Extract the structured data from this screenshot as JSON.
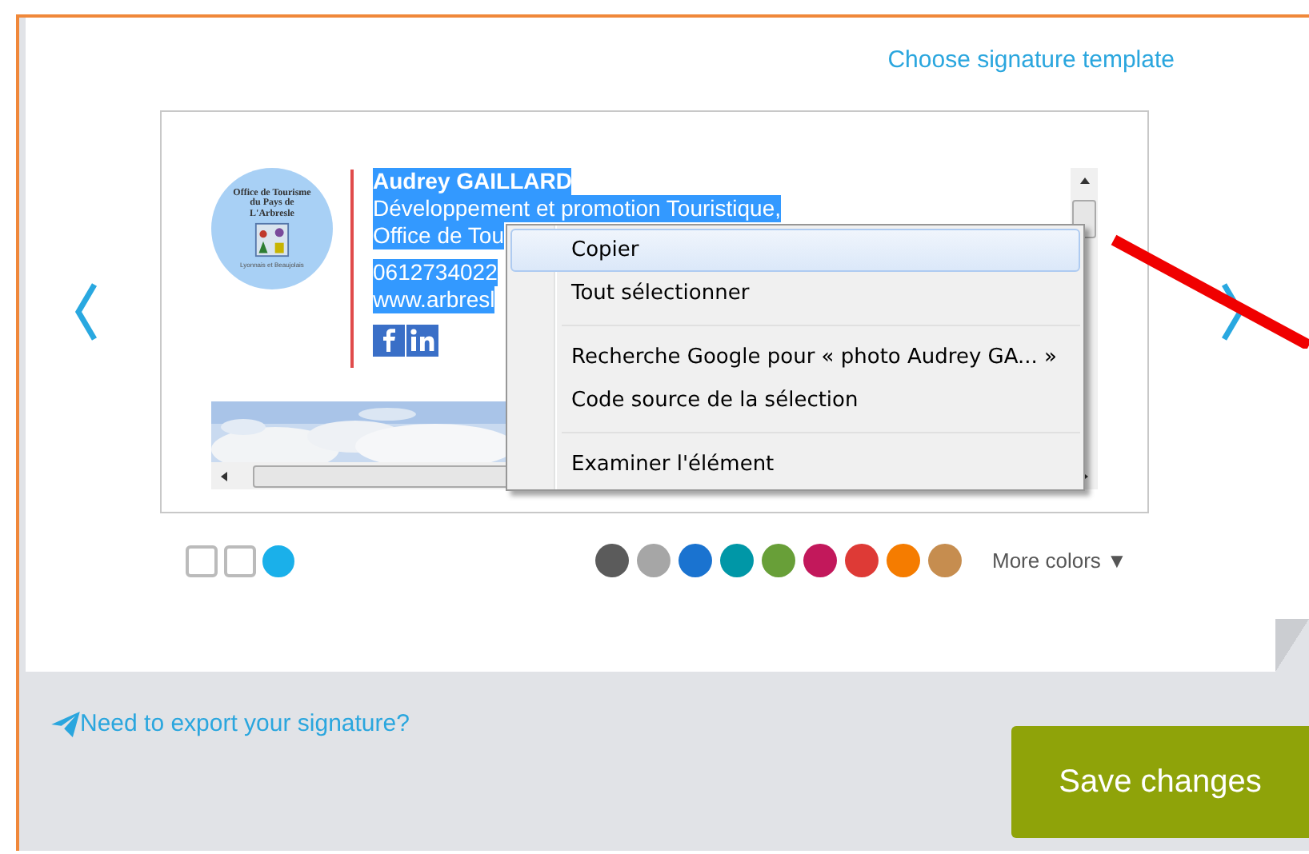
{
  "template_link": "Choose signature template",
  "signature": {
    "logo_text": "Office de Tourisme du Pays de L'Arbresle",
    "logo_subtext": "Lyonnais et Beaujolais",
    "lines": [
      {
        "text": "Audrey GAILLARD",
        "kind": "name"
      },
      {
        "text": "Développement et promotion Touristique,",
        "kind": "line"
      },
      {
        "text": "Office de Tou",
        "kind": "line"
      },
      {
        "text": "0612734022",
        "kind": "contact"
      },
      {
        "text": "www.arbresl",
        "kind": "line"
      }
    ],
    "selected": true
  },
  "context_menu": {
    "groups": [
      [
        {
          "label": "Copier",
          "selected": true
        },
        {
          "label": "Tout sélectionner",
          "selected": false
        }
      ],
      [
        {
          "label": "Recherche Google pour « photo Audrey GA... »",
          "selected": false
        },
        {
          "label": "Code source de la sélection",
          "selected": false
        }
      ],
      [
        {
          "label": "Examiner l'élément",
          "selected": false
        }
      ]
    ]
  },
  "styles": [
    {
      "kind": "square",
      "selected": false
    },
    {
      "kind": "square",
      "selected": false
    },
    {
      "kind": "circle",
      "selected": true
    }
  ],
  "colors": [
    {
      "color": "#5b5b5b"
    },
    {
      "color": "#a6a6a6"
    },
    {
      "color": "#1a73d0"
    },
    {
      "color": "#0097a7"
    },
    {
      "color": "#689f38"
    },
    {
      "color": "#c2185b"
    },
    {
      "color": "#de3a36"
    },
    {
      "color": "#f57c00"
    },
    {
      "color": "#c68d4f"
    }
  ],
  "more_colors": "More colors ▼",
  "export_link": "Need to export your signature?",
  "save_button": "Save changes"
}
